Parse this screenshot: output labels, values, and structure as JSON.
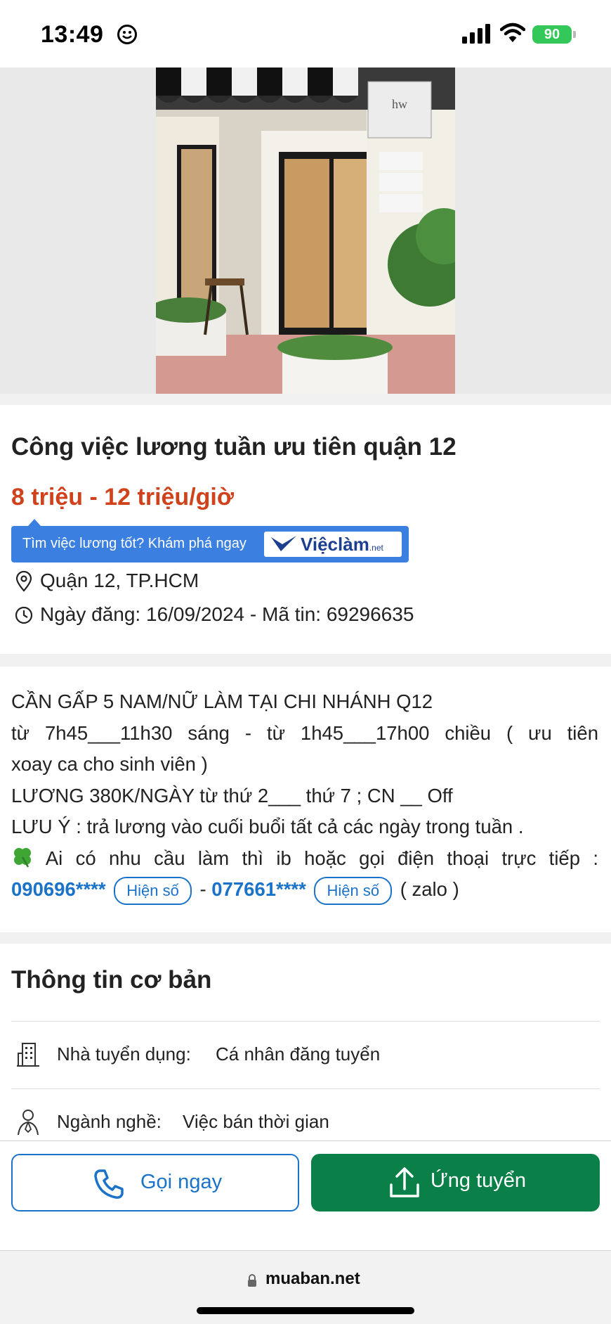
{
  "status_bar": {
    "time": "13:49",
    "battery": "90",
    "icons": [
      "smiley-icon",
      "signal-icon",
      "wifi-icon",
      "battery-icon"
    ]
  },
  "listing": {
    "title": "Công việc lương tuần ưu tiên quận 12",
    "salary": "8 triệu - 12 triệu/giờ",
    "promo": {
      "text": "Tìm việc lương tốt? Khám phá ngay",
      "brand": "Việclàm",
      "brand_suffix": ".net"
    },
    "location": "Quận 12, TP.HCM",
    "posted": "Ngày đăng: 16/09/2024 - Mã tin: 69296635"
  },
  "description": {
    "line1": "CẦN GẤP 5 NAM/NỮ LÀM TẠI CHI NHÁNH Q12",
    "line2": "từ 7h45___11h30 sáng - từ 1h45___17h00 chiều ( ưu tiên",
    "line3": "xoay ca cho sinh viên )",
    "line4": "LƯƠNG 380K/NGÀY từ thứ 2___ thứ 7 ; CN __ Off",
    "line5": "LƯU Ý : trả lương vào cuối buổi tất cả các ngày trong tuần .",
    "line6": "Ai có nhu cầu làm thì ib hoặc gọi điện thoại trực tiếp :",
    "phone1": "090696****",
    "show_label": "Hiện số",
    "separator": "-",
    "phone2": "077661****",
    "suffix": "( zalo )"
  },
  "basic_info": {
    "title": "Thông tin cơ bản",
    "rows": [
      {
        "label": "Nhà tuyển dụng:",
        "value": "Cá nhân đăng tuyển",
        "icon": "building-icon"
      },
      {
        "label": "Ngành nghề:",
        "value": "Việc bán thời gian",
        "icon": "person-icon"
      }
    ]
  },
  "actions": {
    "call": "Gọi ngay",
    "apply": "Ứng tuyển"
  },
  "browser": {
    "url": "muaban.net"
  },
  "colors": {
    "salary": "#d0421b",
    "link": "#1a73c9",
    "apply": "#0a8048",
    "promo": "#3b7fe0"
  }
}
